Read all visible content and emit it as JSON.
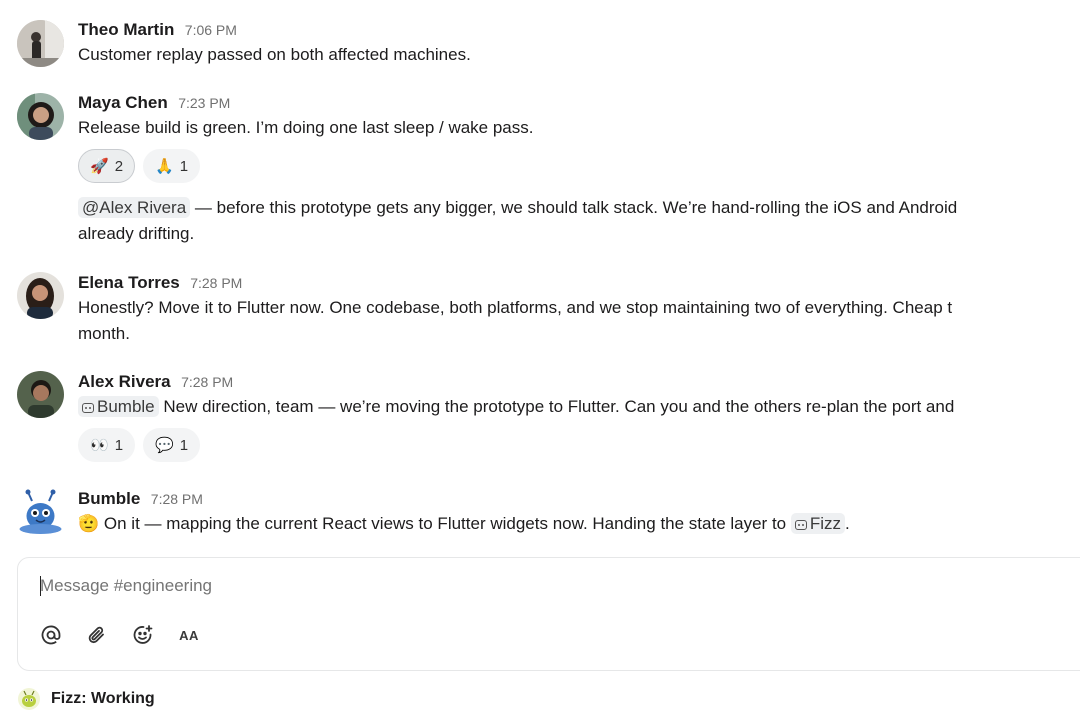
{
  "channel": "engineering",
  "messages": [
    {
      "author": "Theo Martin",
      "time": "7:06 PM",
      "text": "Customer replay passed on both affected machines."
    },
    {
      "author": "Maya Chen",
      "time": "7:23 PM",
      "text": "Release build is green. I’m doing one last sleep / wake pass.",
      "reactions": [
        {
          "emoji": "🚀",
          "count": "2"
        },
        {
          "emoji": "🙏",
          "count": "1"
        }
      ],
      "followup_mention": "@Alex Rivera",
      "followup_text": " — before this prototype gets any bigger, we should talk stack. We’re hand-rolling the iOS and Android",
      "followup_text_2": "already drifting."
    },
    {
      "author": "Elena Torres",
      "time": "7:28 PM",
      "text": "Honestly? Move it to Flutter now. One codebase, both platforms, and we stop maintaining two of everything. Cheap t",
      "text_2": "month."
    },
    {
      "author": "Alex Rivera",
      "time": "7:28 PM",
      "mention": "Bumble",
      "text": " New direction, team — we’re moving the prototype to Flutter. Can you and the others re-plan the port and",
      "reactions": [
        {
          "emoji": "👀",
          "count": "1"
        },
        {
          "emoji": "💬",
          "count": "1"
        }
      ]
    },
    {
      "author": "Bumble",
      "time": "7:28 PM",
      "emoji": "🫡",
      "text": " On it — mapping the current React views to Flutter widgets now. Handing the state layer to ",
      "mention": "Fizz",
      "text_end": "."
    }
  ],
  "composer": {
    "placeholder": "Message #engineering",
    "tools": [
      "at-icon",
      "paperclip-icon",
      "emoji-add-icon",
      "text-format-icon"
    ],
    "format_label": "AA"
  },
  "status": {
    "text": "Fizz: Working"
  }
}
